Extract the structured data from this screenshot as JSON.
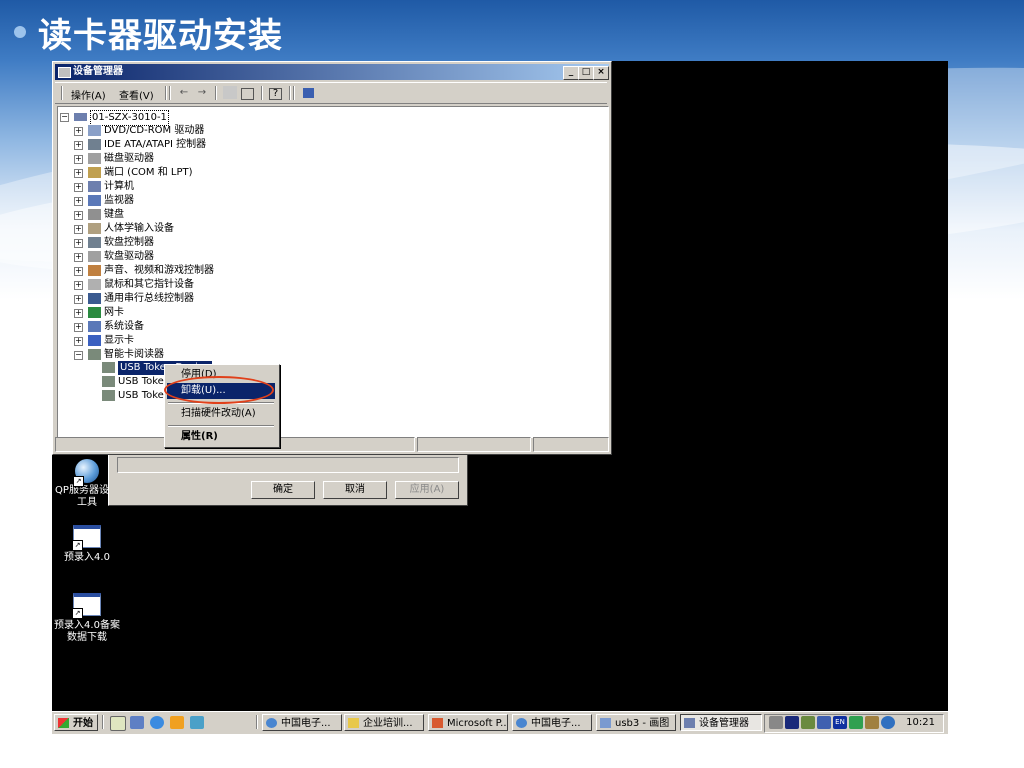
{
  "slide": {
    "title": "读卡器驱动安装"
  },
  "window": {
    "title": "设备管理器",
    "controls": {
      "minimize": "_",
      "maximize": "□",
      "close": "×"
    },
    "menu": {
      "action": "操作(A)",
      "view": "查看(V)"
    },
    "toolbar": {
      "back": "←",
      "forward": "→",
      "help": "?"
    }
  },
  "tree": {
    "root": "01-SZX-3010-1",
    "categories": [
      "DVD/CD-ROM 驱动器",
      "IDE ATA/ATAPI 控制器",
      "磁盘驱动器",
      "端口 (COM 和 LPT)",
      "计算机",
      "监视器",
      "键盘",
      "人体学输入设备",
      "软盘控制器",
      "软盘驱动器",
      "声音、视频和游戏控制器",
      "鼠标和其它指针设备",
      "通用串行总线控制器",
      "网卡",
      "系统设备",
      "显示卡",
      "智能卡阅读器"
    ],
    "children": [
      "USB Token Device",
      "USB Token",
      "USB Token"
    ]
  },
  "context_menu": {
    "disable": "停用(D)",
    "uninstall": "卸载(U)...",
    "scan": "扫描硬件改动(A)",
    "properties": "属性(R)"
  },
  "back_dialog": {
    "ok": "确定",
    "cancel": "取消",
    "apply": "应用(A)"
  },
  "desktop_icons": [
    {
      "label": "QP服务器设置工具"
    },
    {
      "label": "预录入4.0"
    },
    {
      "label": "预录入4.0备案数据下载"
    }
  ],
  "taskbar": {
    "start": "开始",
    "tasks": [
      "中国电子...",
      "企业培训...",
      "Microsoft P...",
      "中国电子...",
      "usb3 - 画图",
      "设备管理器"
    ],
    "clock": "10:21"
  }
}
